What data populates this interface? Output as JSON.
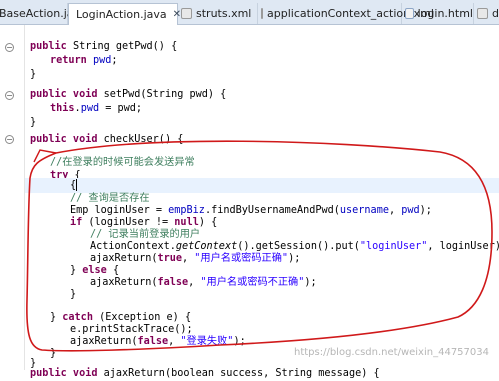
{
  "tabs": [
    {
      "label": "BaseAction.java",
      "icon": "java-file-icon"
    },
    {
      "label": "LoginAction.java",
      "icon": "java-file-icon",
      "active": true
    },
    {
      "label": "struts.xml",
      "icon": "xml-file-icon"
    },
    {
      "label": "applicationContext_action.xml",
      "icon": "xml-file-icon"
    },
    {
      "label": "login.html",
      "icon": "html-file-icon"
    },
    {
      "label": "dep",
      "icon": "xml-file-icon"
    }
  ],
  "code": {
    "l1": {
      "a": "public ",
      "b": "String ",
      "c": "getPwd() {"
    },
    "l2": {
      "a": "return ",
      "b": "pwd",
      "c": ";"
    },
    "l3": "}",
    "l4": {
      "a": "public void ",
      "b": "setPwd(String pwd) {"
    },
    "l5": {
      "a": "this",
      "b": ".",
      "c": "pwd",
      "d": " = pwd;"
    },
    "l6": "}",
    "l7": {
      "a": "public void ",
      "b": "checkUser() {"
    },
    "l8": "//在登录的时候可能会发送异常",
    "l9": "try",
    "l9b": " {",
    "l10": "{",
    "l11": "// 查询是否存在",
    "l12": {
      "a": "Emp loginUser = ",
      "b": "empBiz",
      "c": ".findByUsernameAndPwd(",
      "d": "username",
      "e": ", ",
      "f": "pwd",
      "g": ");"
    },
    "l13": {
      "a": "if",
      "b": " (loginUser != ",
      "c": "null",
      "d": ") {"
    },
    "l14": "// 记录当前登录的用户",
    "l15": {
      "a": "ActionContext.",
      "b": "getContext",
      "c": "().getSession().put(",
      "d": "\"loginUser\"",
      "e": ", loginUser);"
    },
    "l16": {
      "a": "ajaxReturn(",
      "b": "true",
      "c": ", ",
      "d": "\"用户名或密码正确\"",
      "e": ");"
    },
    "l17": {
      "a": "} ",
      "b": "else",
      "c": " {"
    },
    "l18": {
      "a": "ajaxReturn(",
      "b": "false",
      "c": ", ",
      "d": "\"用户名或密码不正确\"",
      "e": ");"
    },
    "l19": "}",
    "l20": {
      "a": "} ",
      "b": "catch",
      "c": " (Exception e) {"
    },
    "l21": "e.printStackTrace();",
    "l22": {
      "a": "ajaxReturn(",
      "b": "false",
      "c": ", ",
      "d": "\"登录失败\"",
      "e": ");"
    },
    "l23": "}",
    "l24": "}",
    "l25": {
      "a": "public void ",
      "b": "ajaxReturn(boolean success, String message) {"
    }
  },
  "watermark": "https://blog.csdn.net/weixin_44757034",
  "colors": {
    "annotation": "#d0191a",
    "keyword": "#7f0055",
    "string": "#2a00ff",
    "comment": "#3f7f5f",
    "field": "#0000c0"
  }
}
